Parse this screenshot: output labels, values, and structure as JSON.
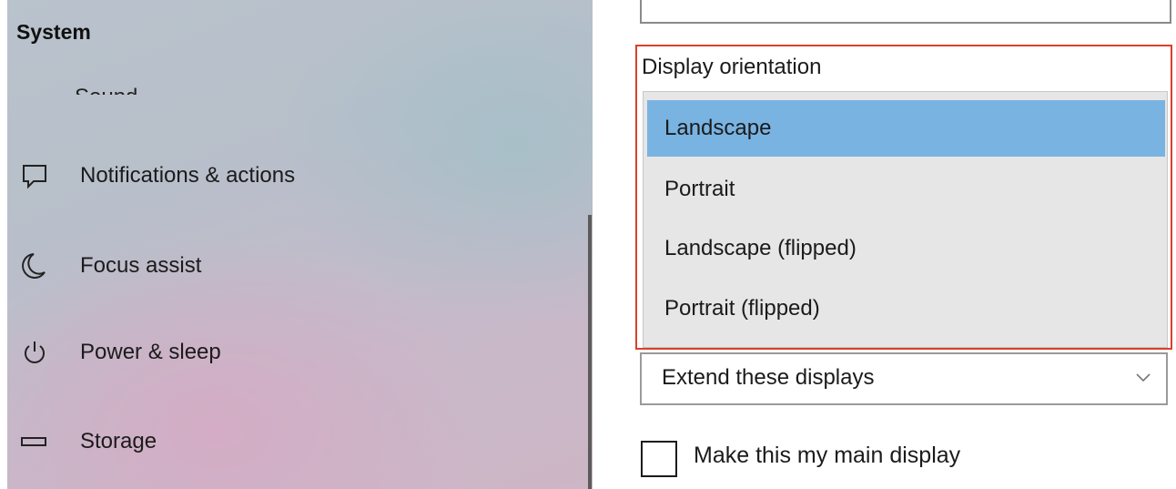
{
  "sidebar": {
    "title": "System",
    "partial_item_label": "Sound",
    "items": [
      {
        "label": "Notifications & actions",
        "icon": "notifications-icon"
      },
      {
        "label": "Focus assist",
        "icon": "moon-icon"
      },
      {
        "label": "Power & sleep",
        "icon": "power-icon"
      },
      {
        "label": "Storage",
        "icon": "storage-icon"
      }
    ]
  },
  "display": {
    "orientation_label": "Display orientation",
    "orientation_options": [
      "Landscape",
      "Portrait",
      "Landscape (flipped)",
      "Portrait (flipped)"
    ],
    "selected_orientation": "Landscape",
    "multiple_displays_value": "Extend these displays",
    "main_display_checkbox_label": "Make this my main display",
    "main_display_checked": false
  },
  "colors": {
    "highlight_border": "#d9402b",
    "selected_option": "#79b3e2",
    "dropdown_background": "#e6e6e6"
  }
}
